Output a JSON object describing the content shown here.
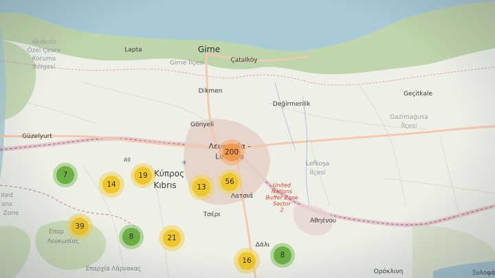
{
  "map": {
    "places": {
      "girne": "Girne",
      "lapta": "Lapta",
      "girne_ilcesi": "Girne İlçesi",
      "catalkoy": "Çatalköy",
      "dikmen": "Dikmen",
      "degirmenlik": "Değirmenlik",
      "gonyeli": "Gönyeli",
      "gecitkale": "Geçitkale",
      "gazimagusa_ilcesi_1": "Gazimağusa",
      "gazimagusa_ilcesi_2": "İlçesi",
      "akdeniz_1": "Akdeniz",
      "akdeniz_2": "Özel Çevre",
      "akdeniz_3": "Koruma",
      "akdeniz_4": "Bölgesi",
      "guzelyurt": "Güzelyurt",
      "lefkosa_1": "Lefkoşa",
      "lefkosa_2": "İlçesi",
      "nicosia_1": "Λευκωσία -",
      "nicosia_2": "Lefkoşa",
      "kypros_1": "Κύπρος",
      "kypros_2": "Kıbrıs",
      "latsia": "Λατσιά",
      "tseri": "Τσέρι",
      "athienou": "Αθηένου",
      "dali": "Δάλι",
      "orokleni": "Ορόκλινη",
      "xylofagou": "Ξυλοφάγ",
      "road_a9": "A9",
      "epar_1": "Επαρ",
      "epar_2": "Λευκωσίας",
      "left_1": "ited",
      "left_2": "ons",
      "left_3": "Zone",
      "bottom_place": "Επαρχία Λάρνακας",
      "buffer_zone": [
        "United",
        "Nations",
        "Buffer Zone",
        "Sector",
        "2"
      ]
    },
    "clusters": [
      {
        "count": "200",
        "color": "orange"
      },
      {
        "count": "56",
        "color": "yellow"
      },
      {
        "count": "13",
        "color": "yellow"
      },
      {
        "count": "19",
        "color": "yellow"
      },
      {
        "count": "14",
        "color": "yellow"
      },
      {
        "count": "7",
        "color": "green"
      },
      {
        "count": "39",
        "color": "yellow"
      },
      {
        "count": "8",
        "color": "green"
      },
      {
        "count": "21",
        "color": "yellow"
      },
      {
        "count": "16",
        "color": "yellow"
      },
      {
        "count": "8",
        "color": "green"
      }
    ],
    "colors": {
      "sea": "#a9cbd6",
      "land": "#eef0e8",
      "forest": "#b5cfa0",
      "urban": "#e3d2c8",
      "road_major": "#f5bda0",
      "border": "#c98aa0",
      "cluster_yellow": "#f0c72a",
      "cluster_green": "#6cb043",
      "cluster_orange": "#f19a4d"
    }
  }
}
